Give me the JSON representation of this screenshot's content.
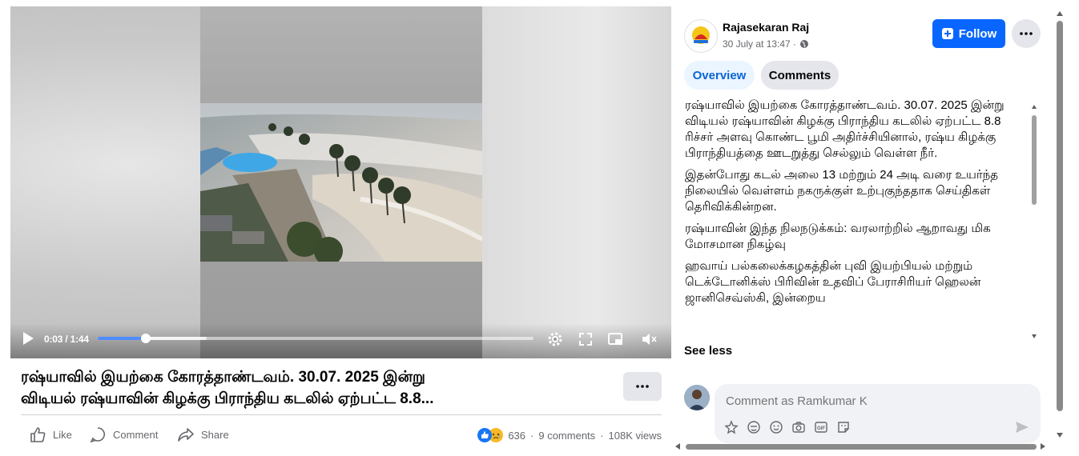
{
  "video": {
    "time_display": "0:03 / 1:44",
    "progress_fraction": 0.11,
    "buffered_fraction": 0.25
  },
  "post": {
    "title_line1": "ரஷ்யாவில் இயற்கை கோரத்தாண்டவம். 30.07. 2025 இன்று",
    "title_line2": "விடியல் ரஷ்யாவின் கிழக்கு பிராந்திய கடலில் ஏற்பட்ட 8.8..."
  },
  "actions": {
    "like": "Like",
    "comment": "Comment",
    "share": "Share"
  },
  "stats": {
    "reactions": "636",
    "separator": "·",
    "comments": "9 comments",
    "views": "108K views"
  },
  "author": {
    "name": "Rajasekaran Raj",
    "timestamp": "30 July at 13:47 ·"
  },
  "header": {
    "follow_label": "Follow"
  },
  "tabs": [
    {
      "label": "Overview",
      "active": true
    },
    {
      "label": "Comments",
      "active": false
    }
  ],
  "description": {
    "p1": "ரஷ்யாவில் இயற்கை கோரத்தாண்டவம். 30.07. 2025 இன்று விடியல் ரஷ்யாவின் கிழக்கு பிராந்திய கடலில் ஏற்பட்ட 8.8 ரிச்சர் அளவு கொண்ட பூமி அதிர்ச்சியினால், ரஷ்ய கிழக்கு பிராந்தியத்தை ஊடறுத்து செல்லும் வெள்ள நீர்.",
    "p2_a": "இதன்போது கடல் அலை 13 மற்றும் 24 அடி வரை உயர்ந்த",
    "p2_b": "நிலையில் வெள்ளம் நகருக்குள் உற்புகுந்ததாக செய்திகள் தெரிவிக்கின்றன.",
    "p3": "ரஷ்யாவின் இந்த நிலநடுக்கம்: வரலாற்றில் ஆறாவது மிக மோசமான நிகழ்வு",
    "p4": "ஹவாய் பல்கலைக்கழகத்தின் புவி இயற்பியல் மற்றும் டெக்டோனிக்ஸ் பிரிவின் உதவிப் பேராசிரியர் ஹெலன் ஜானிசெவ்ஸ்கி, இன்றைய",
    "see_less": "See less"
  },
  "comment_box": {
    "placeholder": "Comment as Ramkumar K"
  },
  "colors": {
    "accent": "#0866ff",
    "tab_active_bg": "#ebf5ff",
    "tab_active_text": "#0a64d6",
    "secondary_text": "#65676b",
    "button_gray": "#e4e6eb",
    "progress": "#4e8cff"
  },
  "icons": [
    "play-icon",
    "settings-icon",
    "fullscreen-icon",
    "miniplayer-icon",
    "mute-icon",
    "like-icon",
    "comment-icon",
    "share-icon",
    "globe-icon",
    "follow-plus-icon",
    "more-icon",
    "sticker-icon",
    "avatar-emoji-icon",
    "emoji-icon",
    "camera-icon",
    "gif-icon",
    "sticker-face-icon",
    "send-icon"
  ]
}
